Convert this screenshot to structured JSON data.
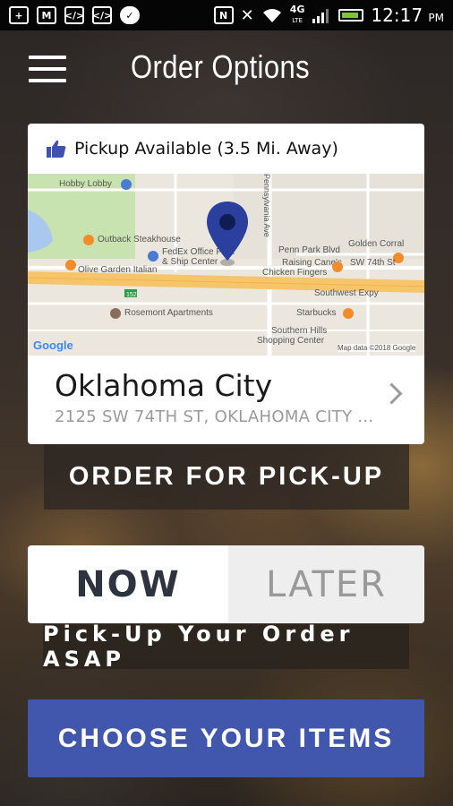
{
  "status_bar": {
    "time": "12:17",
    "ampm": "PM",
    "network": "4G",
    "network_sub": "LTE",
    "icons": [
      "add-icon",
      "gmail-icon",
      "code-icon",
      "code-icon",
      "chat-icon",
      "nfc-icon",
      "mute-icon",
      "wifi-icon",
      "signal-icon",
      "battery-icon"
    ]
  },
  "header": {
    "title": "Order Options",
    "menu_icon": "hamburger-icon"
  },
  "location_card": {
    "pickup_text": "Pickup Available (3.5 Mi. Away)",
    "city": "Oklahoma City",
    "address": "2125 SW 74TH ST, OKLAHOMA CITY ..."
  },
  "map": {
    "labels": {
      "hobby_lobby": "Hobby Lobby",
      "outback": "Outback Steakhouse",
      "fedex": "FedEx Office Print",
      "fedex2": "& Ship Center",
      "olive_garden": "Olive Garden Italian",
      "penn_park": "Penn Park Blvd",
      "golden_corral": "Golden Corral",
      "sw74": "SW 74th St",
      "raising_canes": "Raising Cane's",
      "raising_canes2": "Chicken Fingers",
      "southwest_expy": "Southwest Expy",
      "rosemont": "Rosemont Apartments",
      "starbucks": "Starbucks",
      "southern_hills": "Southern Hills",
      "shopping_center": "Shopping Center",
      "pennsylvania": "Pennsylvania Ave",
      "google": "Google",
      "map_data": "Map data ©2018 Google",
      "highway_shield": "152"
    },
    "colors": {
      "marker": "#2b3f9e",
      "highway": "#f6c56b",
      "park": "#c9e3b0",
      "water": "#a8c8f0"
    }
  },
  "buttons": {
    "order_pickup": "ORDER FOR PICK-UP",
    "now": "NOW",
    "later": "LATER",
    "asap": "Pick-Up Your Order ASAP",
    "choose_items": "CHOOSE YOUR ITEMS"
  },
  "colors": {
    "accent": "#4156ad",
    "card_bg": "#ffffff",
    "now_text": "#2e3340",
    "thumb": "#3f51b5"
  }
}
